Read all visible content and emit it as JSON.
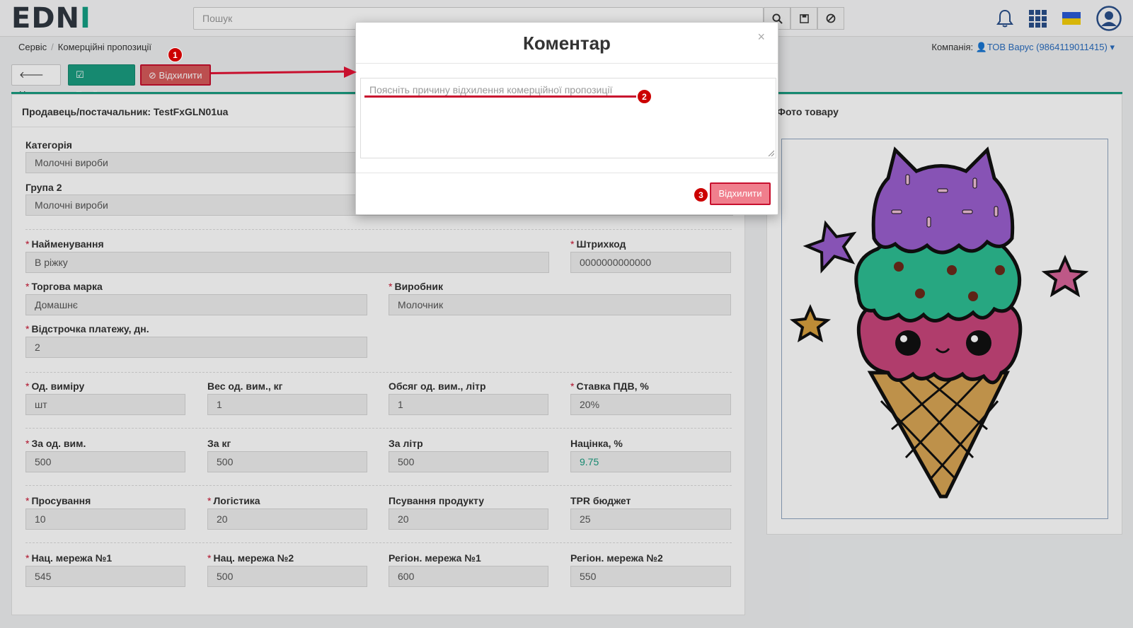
{
  "navbar": {
    "logo_left": "ED",
    "logo_n": "N",
    "logo_i": "I",
    "search_placeholder": "Пошук"
  },
  "breadcrumb": [
    "Сервіс",
    "Комерційні пропозиції"
  ],
  "company": {
    "label": "Компанія:",
    "value": "ТОВ Варус (9864119011415)"
  },
  "toolbar": {
    "back": "Назад",
    "accept": "Прийняти",
    "reject": "Відхилити"
  },
  "seller": "Продавець/постачальник: TestFxGLN01ua",
  "photo_title": "Фото товару",
  "fields": {
    "category": {
      "label": "Категорія",
      "value": "Молочні вироби"
    },
    "group2": {
      "label": "Група 2",
      "value": "Молочні вироби"
    },
    "name": {
      "label": "Найменування",
      "value": "В ріжку"
    },
    "barcode": {
      "label": "Штрихкод",
      "value": "0000000000000"
    },
    "brand": {
      "label": "Торгова марка",
      "value": "Домашнє"
    },
    "producer": {
      "label": "Виробник",
      "value": "Молочник"
    },
    "deferral": {
      "label": "Відстрочка платежу, дн.",
      "value": "2"
    },
    "unit": {
      "label": "Од. виміру",
      "value": "шт"
    },
    "weight": {
      "label": "Вес од. вим., кг",
      "value": "1"
    },
    "volume": {
      "label": "Обсяг од. вим., літр",
      "value": "1"
    },
    "vat": {
      "label": "Ставка ПДВ, %",
      "value": "20%"
    },
    "per_unit": {
      "label": "За од. вим.",
      "value": "500"
    },
    "per_kg": {
      "label": "За кг",
      "value": "500"
    },
    "per_liter": {
      "label": "За літр",
      "value": "500"
    },
    "markup": {
      "label": "Націнка, %",
      "value": "9.75"
    },
    "promotion": {
      "label": "Просування",
      "value": "10"
    },
    "logistics": {
      "label": "Логістика",
      "value": "20"
    },
    "spoilage": {
      "label": "Псування продукту",
      "value": "20"
    },
    "tpr": {
      "label": "TPR бюджет",
      "value": "25"
    },
    "nat1": {
      "label": "Нац. мережа №1",
      "value": "545"
    },
    "nat2": {
      "label": "Нац. мережа №2",
      "value": "500"
    },
    "reg1": {
      "label": "Регіон. мережа №1",
      "value": "600"
    },
    "reg2": {
      "label": "Регіон. мережа №2",
      "value": "550"
    }
  },
  "modal": {
    "title": "Коментар",
    "close": "×",
    "placeholder": "Поясніть причину відхилення комерційної пропозиції",
    "reject_button": "Відхилити"
  },
  "annotations": [
    "1",
    "2",
    "3"
  ],
  "colors": {
    "accent_green": "#1a9c80",
    "danger_red": "#c8102e",
    "link_blue": "#2a6dbf"
  }
}
